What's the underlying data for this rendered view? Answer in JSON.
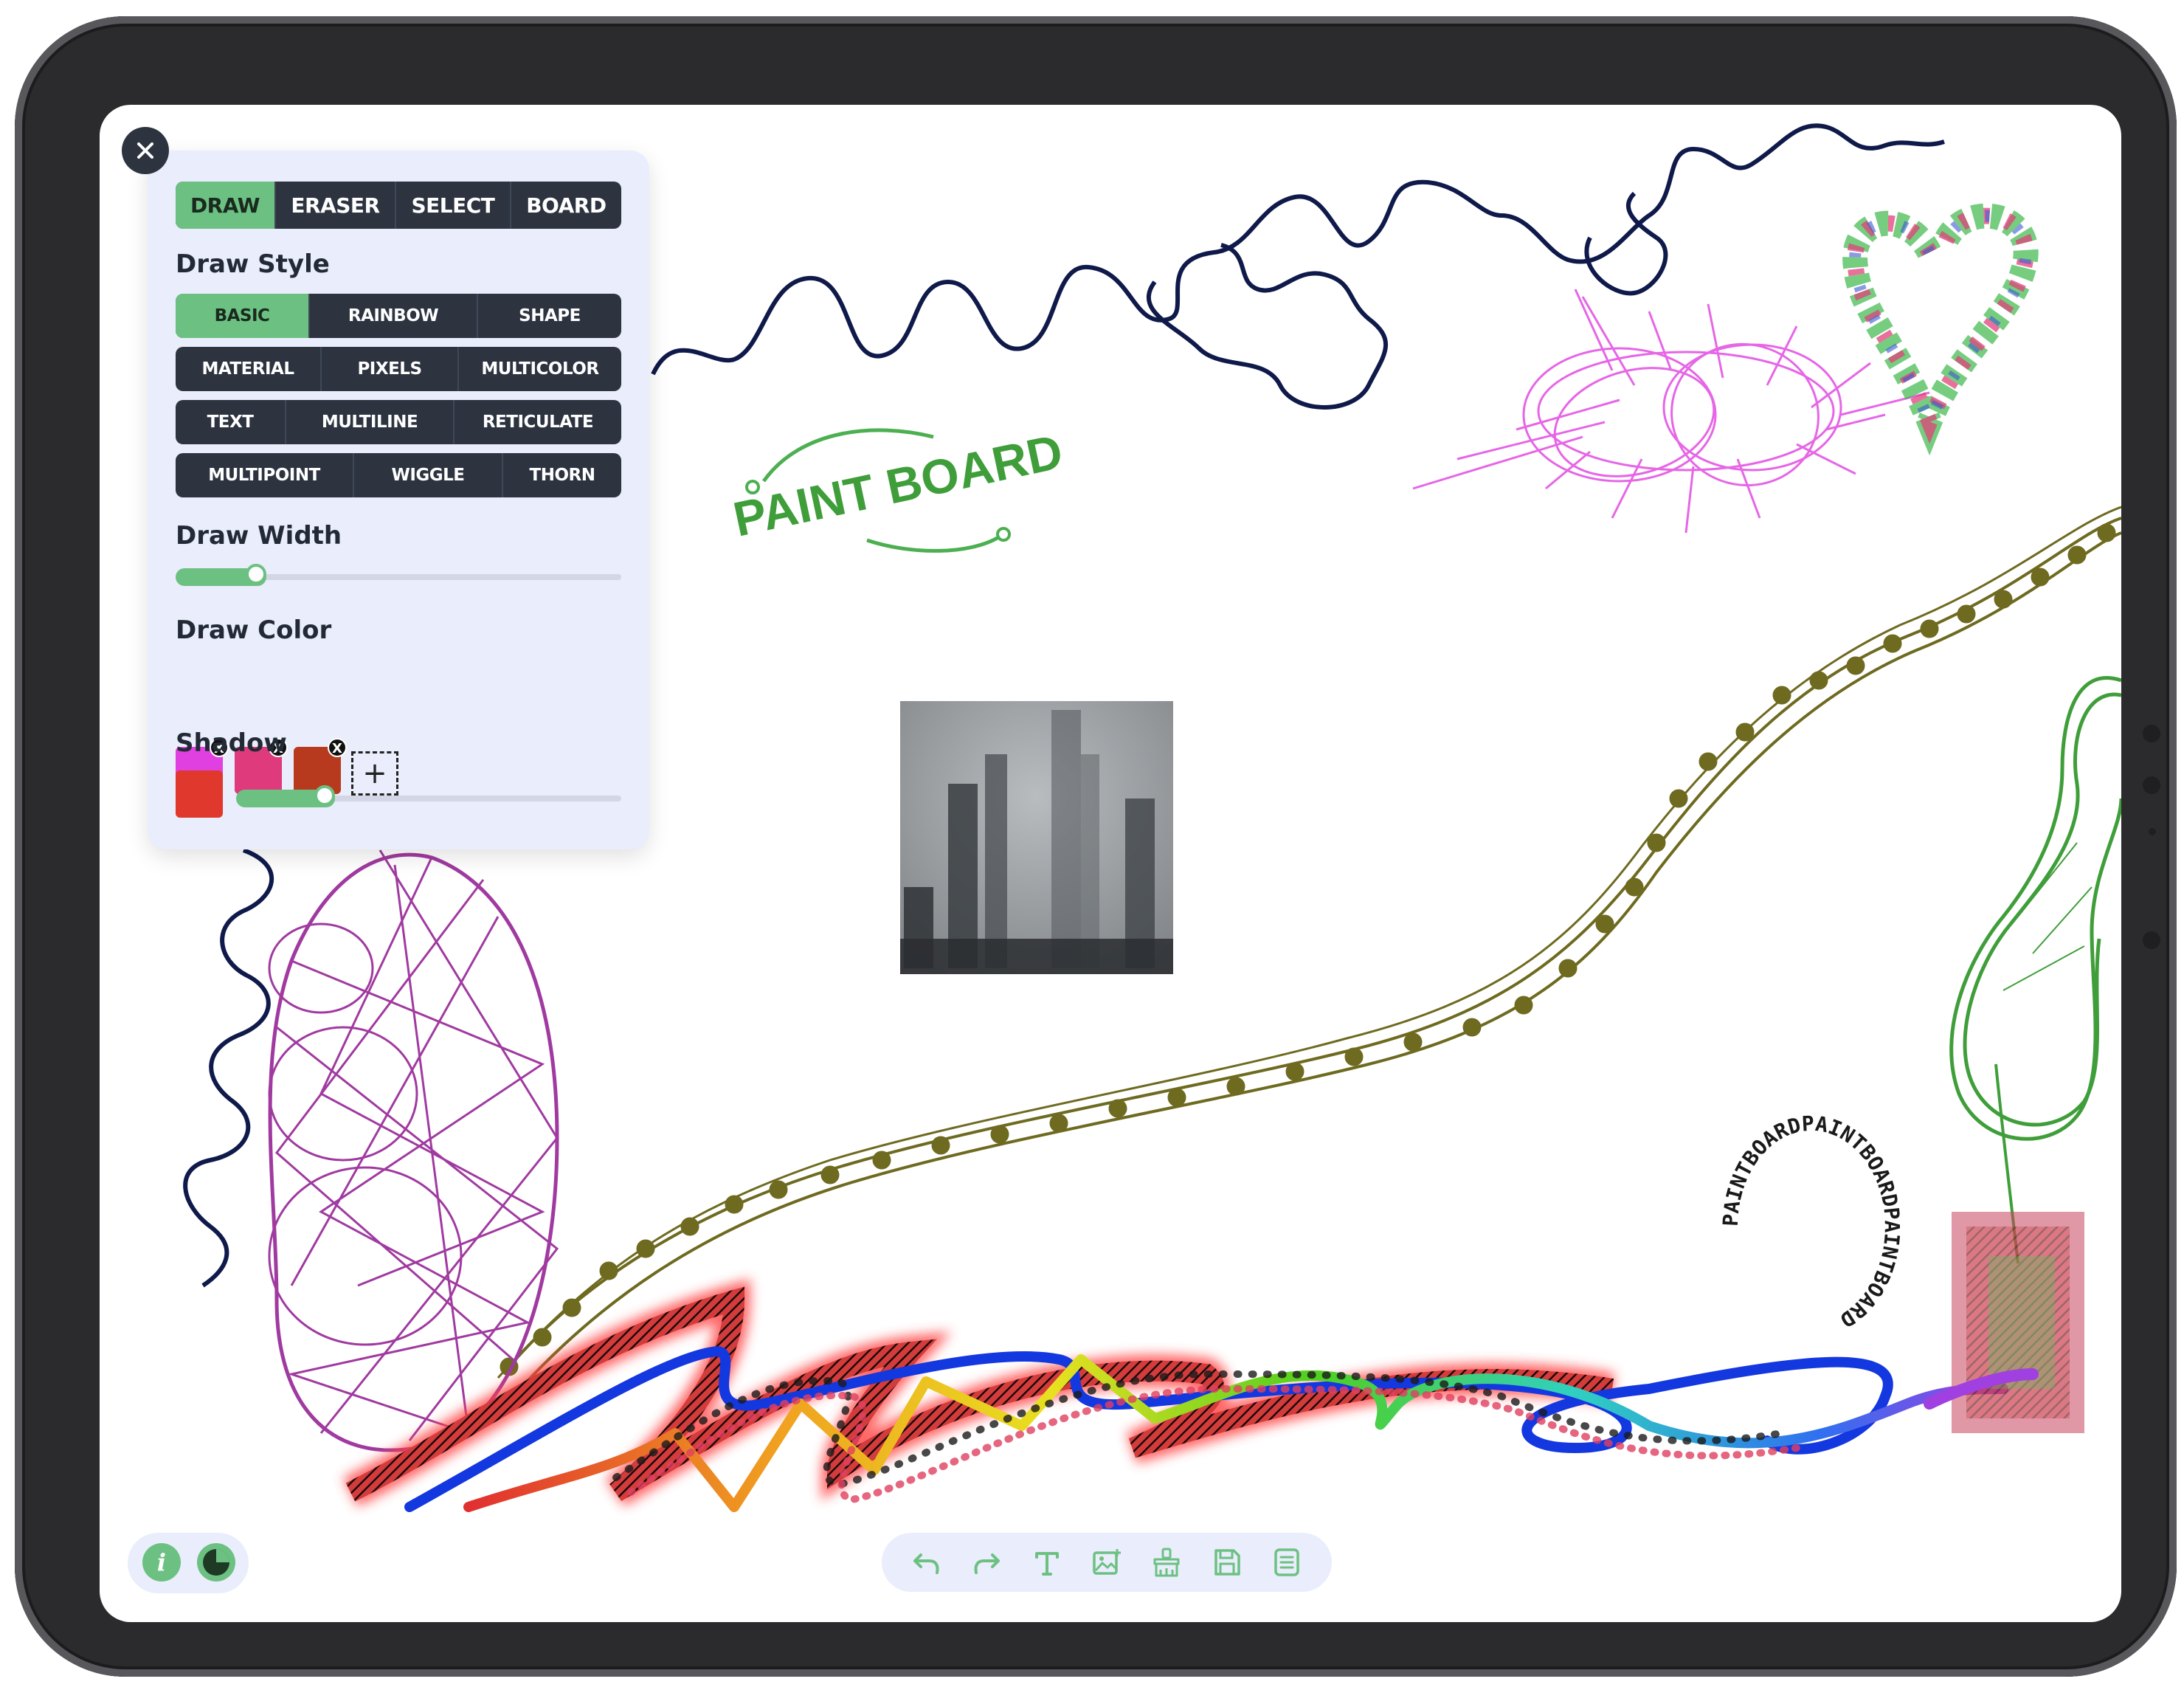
{
  "tabs": [
    "DRAW",
    "ERASER",
    "SELECT",
    "BOARD"
  ],
  "tabs_active": 0,
  "draw_style": {
    "title": "Draw Style",
    "rows": [
      [
        "BASIC",
        "RAINBOW",
        "SHAPE"
      ],
      [
        "MATERIAL",
        "PIXELS",
        "MULTICOLOR"
      ],
      [
        "TEXT",
        "MULTILINE",
        "RETICULATE"
      ],
      [
        "MULTIPOINT",
        "WIGGLE",
        "THORN"
      ]
    ],
    "active": "BASIC"
  },
  "draw_width": {
    "title": "Draw Width",
    "value": 0.18
  },
  "draw_color": {
    "title": "Draw Color",
    "swatches": [
      "#e040e0",
      "#df3a7c",
      "#b83a1e"
    ],
    "remove_mark": "X",
    "add_symbol": "+"
  },
  "shadow": {
    "title": "Shadow",
    "color": "#e0382c",
    "value": 0.23
  },
  "canvas": {
    "logo_text": "PAINT BOARD",
    "circle_text": "PAINTBOARDPAINTBOARDPAINTBOARD"
  },
  "info_button": {
    "label": "i"
  },
  "toolbar_icons": [
    "undo-icon",
    "redo-icon",
    "text-icon",
    "image-icon",
    "clear-icon",
    "save-icon",
    "list-icon"
  ],
  "colors": {
    "accent": "#6cc182",
    "panel_bg": "#eaedfb",
    "button_dark": "#2d3440",
    "wiggle_navy": "#0f1a4a",
    "olive": "#6e6a20",
    "magenta": "#e040e0",
    "purple": "#a03aa0",
    "green": "#3f9e3a",
    "blue": "#1438e0"
  }
}
